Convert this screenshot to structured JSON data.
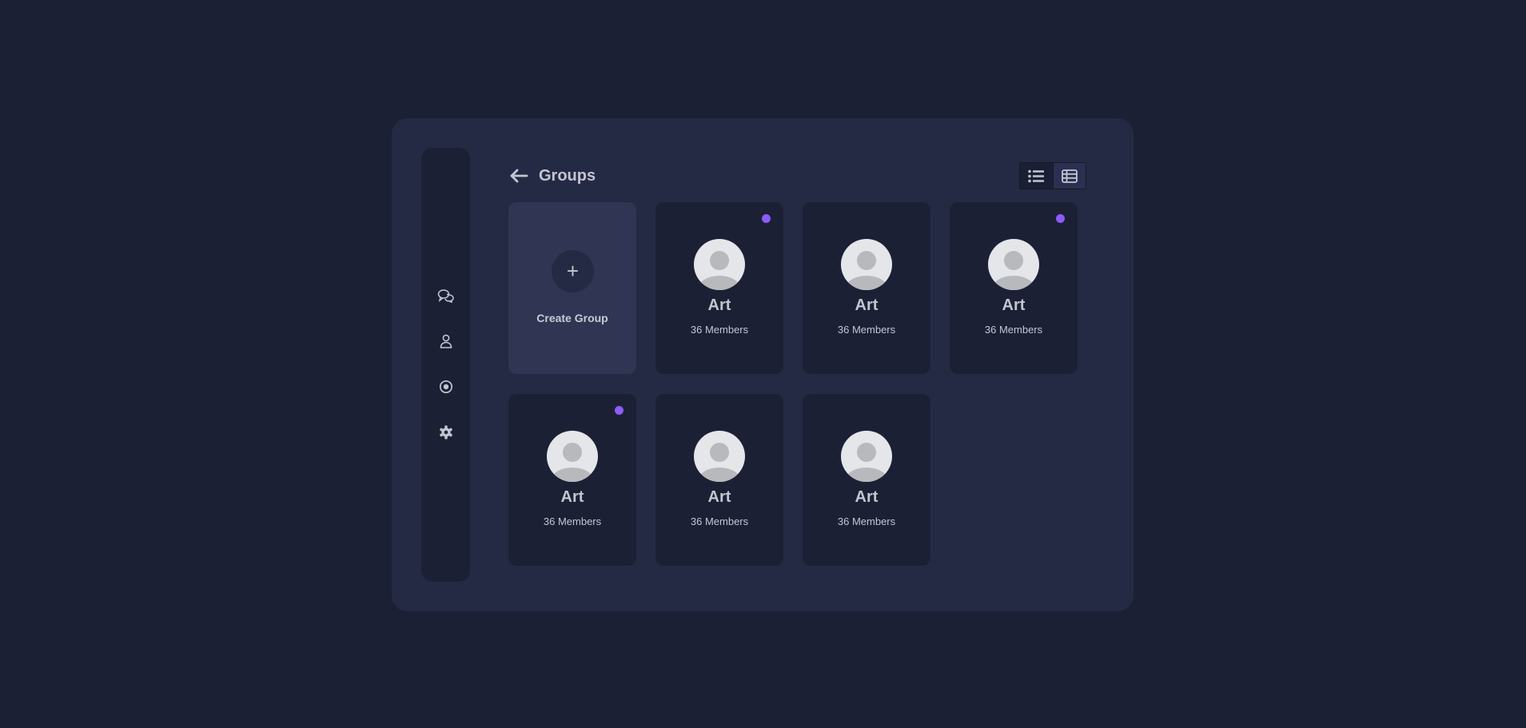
{
  "colors": {
    "page_bg": "#1c2035",
    "panel_bg": "#252a44",
    "card_bg": "#1c2035",
    "create_card_bg": "#2f3552",
    "accent_dot": "#8b5cf6",
    "text": "#c3c5d1"
  },
  "sidebar": {
    "items": [
      {
        "icon": "chat-icon"
      },
      {
        "icon": "user-icon"
      },
      {
        "icon": "radio-icon"
      },
      {
        "icon": "gear-icon"
      }
    ]
  },
  "header": {
    "back_icon": "arrow-left-icon",
    "title": "Groups",
    "view_toggle": [
      {
        "icon": "list-view-icon"
      },
      {
        "icon": "table-view-icon"
      }
    ]
  },
  "create_card": {
    "plus": "+",
    "label": "Create Group"
  },
  "groups": [
    {
      "name": "Art",
      "members": "36 Members",
      "unread": true
    },
    {
      "name": "Art",
      "members": "36 Members",
      "unread": false
    },
    {
      "name": "Art",
      "members": "36 Members",
      "unread": true
    },
    {
      "name": "Art",
      "members": "36 Members",
      "unread": true
    },
    {
      "name": "Art",
      "members": "36 Members",
      "unread": false
    },
    {
      "name": "Art",
      "members": "36 Members",
      "unread": false
    }
  ]
}
